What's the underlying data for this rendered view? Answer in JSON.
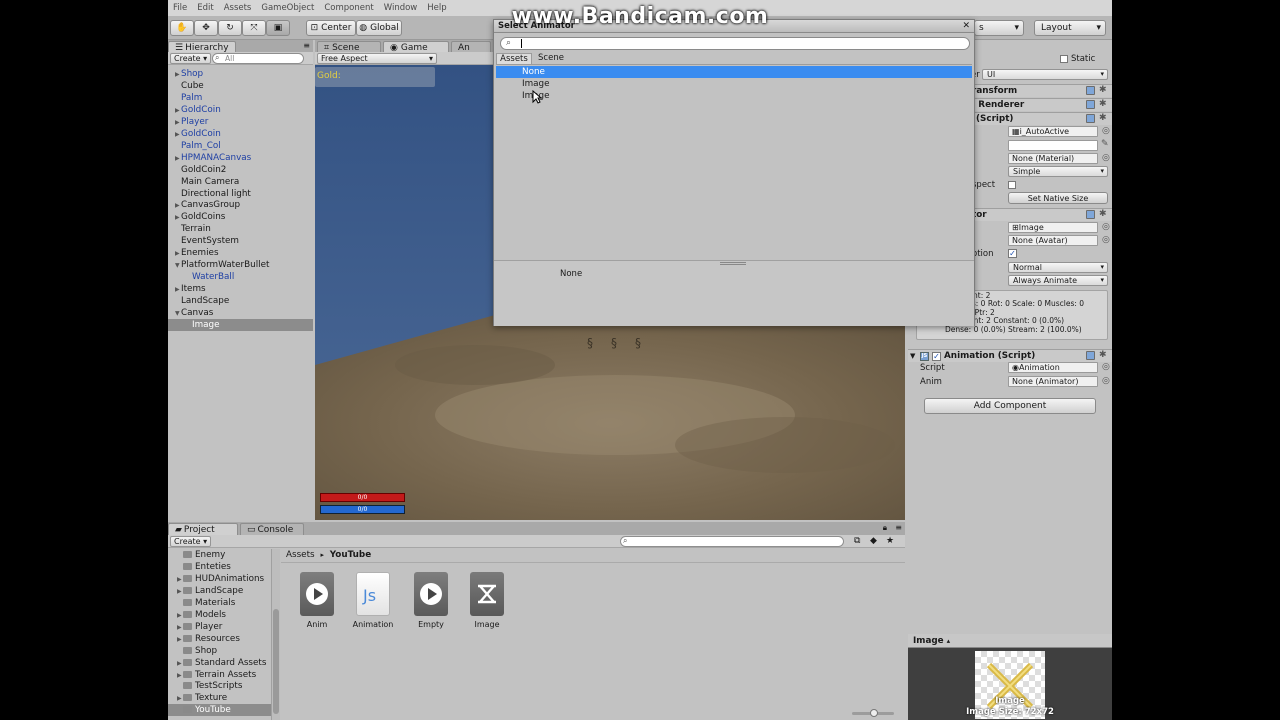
{
  "menu": [
    "File",
    "Edit",
    "Assets",
    "GameObject",
    "Component",
    "Window",
    "Help"
  ],
  "toolbar": {
    "pivot_label": "Center",
    "space_label": "Global",
    "layers_label": "s",
    "layout_label": "Layout"
  },
  "hierarchy": {
    "tab_label": "Hierarchy",
    "create_label": "Create",
    "search_placeholder": "All",
    "items": [
      {
        "label": "Shop",
        "arrow": "▶",
        "prefab": true
      },
      {
        "label": "Cube",
        "arrow": "",
        "prefab": false
      },
      {
        "label": "Palm",
        "arrow": "",
        "prefab": true
      },
      {
        "label": "GoldCoin",
        "arrow": "▶",
        "prefab": true
      },
      {
        "label": "Player",
        "arrow": "▶",
        "prefab": true
      },
      {
        "label": "GoldCoin",
        "arrow": "▶",
        "prefab": true
      },
      {
        "label": "Palm_Col",
        "arrow": "",
        "prefab": true
      },
      {
        "label": "HPMANACanvas",
        "arrow": "▶",
        "prefab": true
      },
      {
        "label": "GoldCoin2",
        "arrow": "",
        "prefab": false
      },
      {
        "label": "Main Camera",
        "arrow": "",
        "prefab": false
      },
      {
        "label": "Directional light",
        "arrow": "",
        "prefab": false
      },
      {
        "label": "CanvasGroup",
        "arrow": "▶",
        "prefab": false
      },
      {
        "label": "GoldCoins",
        "arrow": "▶",
        "prefab": false
      },
      {
        "label": "Terrain",
        "arrow": "",
        "prefab": false
      },
      {
        "label": "EventSystem",
        "arrow": "",
        "prefab": false
      },
      {
        "label": "Enemies",
        "arrow": "▶",
        "prefab": false
      },
      {
        "label": "PlatformWaterBullet",
        "arrow": "▼",
        "prefab": false
      },
      {
        "label": "WaterBall",
        "arrow": "",
        "prefab": true,
        "indent": true
      },
      {
        "label": "Items",
        "arrow": "▶",
        "prefab": false
      },
      {
        "label": "LandScape",
        "arrow": "",
        "prefab": false
      },
      {
        "label": "Canvas",
        "arrow": "▼",
        "prefab": false
      },
      {
        "label": "Image",
        "arrow": "",
        "prefab": false,
        "indent": true,
        "selected": true
      }
    ]
  },
  "scene_tabs": {
    "scene_label": "Scene",
    "game_label": "Game",
    "animation_label": "An"
  },
  "game_view": {
    "aspect_label": "Free Aspect",
    "gold_label": "Gold:",
    "hp_text": "0/0",
    "mana_text": "0/0"
  },
  "dialog": {
    "title": "Select Animator",
    "search_value": "",
    "tabs": [
      "Assets",
      "Scene"
    ],
    "items": [
      "None",
      "Image",
      "Image"
    ],
    "preview_label": "None"
  },
  "inspector": {
    "static_label": "Static",
    "layer_label": "Layer",
    "layer_value": "UI",
    "tag_value": "ed",
    "transform_label": "ransform",
    "renderer_label": "s Renderer",
    "image_script_label": "(Script)",
    "source_field": "i_AutoActive",
    "material_field": "None (Material)",
    "image_type": "Simple",
    "aspect_label": "spect",
    "native_size_button": "Set Native Size",
    "animator_label": "tor",
    "controller_field": "Image",
    "avatar_field": "None (Avatar)",
    "root_motion_label": "otion",
    "update_mode": "Normal",
    "culling_mode": "Always Animate",
    "stats_lines": [
      "nt: 2",
      "Pos: 0 Rot: 0 Scale: 0 Muscles: 0",
      "0 PPtr: 2",
      "Count: 2 Constant: 0 (0.0%)",
      "Dense: 0 (0.0%) Stream: 2 (100.0%)"
    ],
    "animation_header": "Animation (Script)",
    "script_label": "Script",
    "script_value": "Animation",
    "anim_label": "Anim",
    "anim_value": "None (Animator)",
    "add_component_label": "Add Component"
  },
  "project": {
    "tab_label": "Project",
    "console_label": "Console",
    "create_label": "Create",
    "folders": [
      {
        "label": "Enemy",
        "arrow": ""
      },
      {
        "label": "Enteties",
        "arrow": ""
      },
      {
        "label": "HUDAnimations",
        "arrow": "▶"
      },
      {
        "label": "LandScape",
        "arrow": "▶"
      },
      {
        "label": "Materials",
        "arrow": ""
      },
      {
        "label": "Models",
        "arrow": "▶"
      },
      {
        "label": "Player",
        "arrow": "▶"
      },
      {
        "label": "Resources",
        "arrow": "▶"
      },
      {
        "label": "Shop",
        "arrow": ""
      },
      {
        "label": "Standard Assets",
        "arrow": "▶"
      },
      {
        "label": "Terrain Assets",
        "arrow": "▶"
      },
      {
        "label": "TestScripts",
        "arrow": ""
      },
      {
        "label": "Texture",
        "arrow": "▶"
      },
      {
        "label": "YouTube",
        "arrow": "",
        "selected": true
      }
    ],
    "breadcrumb_root": "Assets",
    "breadcrumb_sep": "▸",
    "breadcrumb_current": "YouTube",
    "assets": [
      {
        "label": "Anim",
        "kind": "anim"
      },
      {
        "label": "Animation",
        "kind": "js"
      },
      {
        "label": "Empty",
        "kind": "anim"
      },
      {
        "label": "Image",
        "kind": "controller"
      }
    ]
  },
  "preview": {
    "title": "Image",
    "caption1": "Image",
    "caption2": "Image Size: 72x72"
  },
  "watermark": "www.Bandicam.com",
  "colors": {
    "selection_blue": "#3a8cf0",
    "sky": "#3c5c8e",
    "ground": "#7a6a52",
    "prefab_blue": "#1e3fa4"
  }
}
